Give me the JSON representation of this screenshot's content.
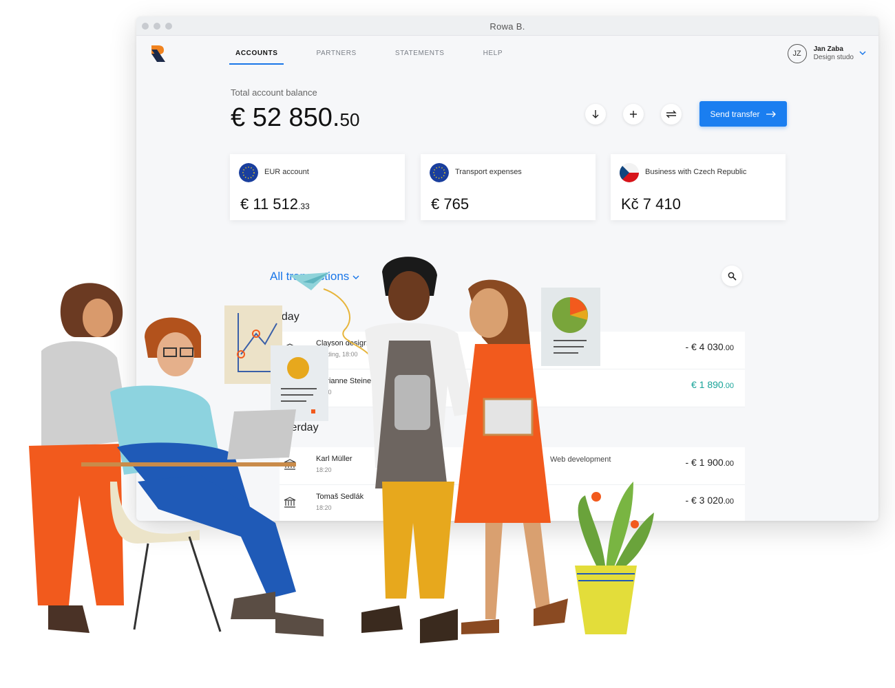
{
  "window": {
    "title": "Rowa B."
  },
  "nav": {
    "items": [
      "ACCOUNTS",
      "PARTNERS",
      "STATEMENTS",
      "HELP"
    ],
    "active": 0
  },
  "user": {
    "initials": "JZ",
    "name": "Jan Zaba",
    "subtitle": "Design studo"
  },
  "balance": {
    "label": "Total account balance",
    "main": "€ 52 850.",
    "cents": "50"
  },
  "actions": {
    "download_icon": "arrow-down-icon",
    "add_icon": "plus-icon",
    "exchange_icon": "exchange-icon"
  },
  "send_transfer": {
    "label": "Send transfer"
  },
  "accounts": [
    {
      "name": "EUR account",
      "flag": "eu-flag-icon",
      "amount": "€ 11 512",
      "cents": ".33"
    },
    {
      "name": "Transport expenses",
      "flag": "eu-flag-icon",
      "amount": "€ 765",
      "cents": ""
    },
    {
      "name": "Business with Czech Republic",
      "flag": "czech-flag-icon",
      "amount": "Kč 7 410",
      "cents": ""
    }
  ],
  "transactions": {
    "filter_label": "All transactions",
    "groups": [
      {
        "label": "Today",
        "rows": [
          {
            "name": "Clayson design",
            "sub": "Pending, 18:00",
            "note": "",
            "amount": "- € 4 030",
            "cents": ".00",
            "positive": false
          },
          {
            "name": "Marianne Steiner",
            "sub": "18:00",
            "note": "",
            "amount": "€ 1 890",
            "cents": ".00",
            "positive": true
          }
        ]
      },
      {
        "label": "Yesterday",
        "rows": [
          {
            "name": "Karl Müller",
            "sub": "18:20",
            "note": "Web development",
            "amount": "- € 1 900",
            "cents": ".00",
            "positive": false
          },
          {
            "name": "Tomaš Sedlák",
            "sub": "18:20",
            "note": "",
            "amount": "- € 3 020",
            "cents": ".00",
            "positive": false
          }
        ]
      }
    ]
  },
  "colors": {
    "accent": "#1a7ef0",
    "positive": "#17a398",
    "orange": "#f25a1d",
    "yellow": "#e7a81d"
  }
}
